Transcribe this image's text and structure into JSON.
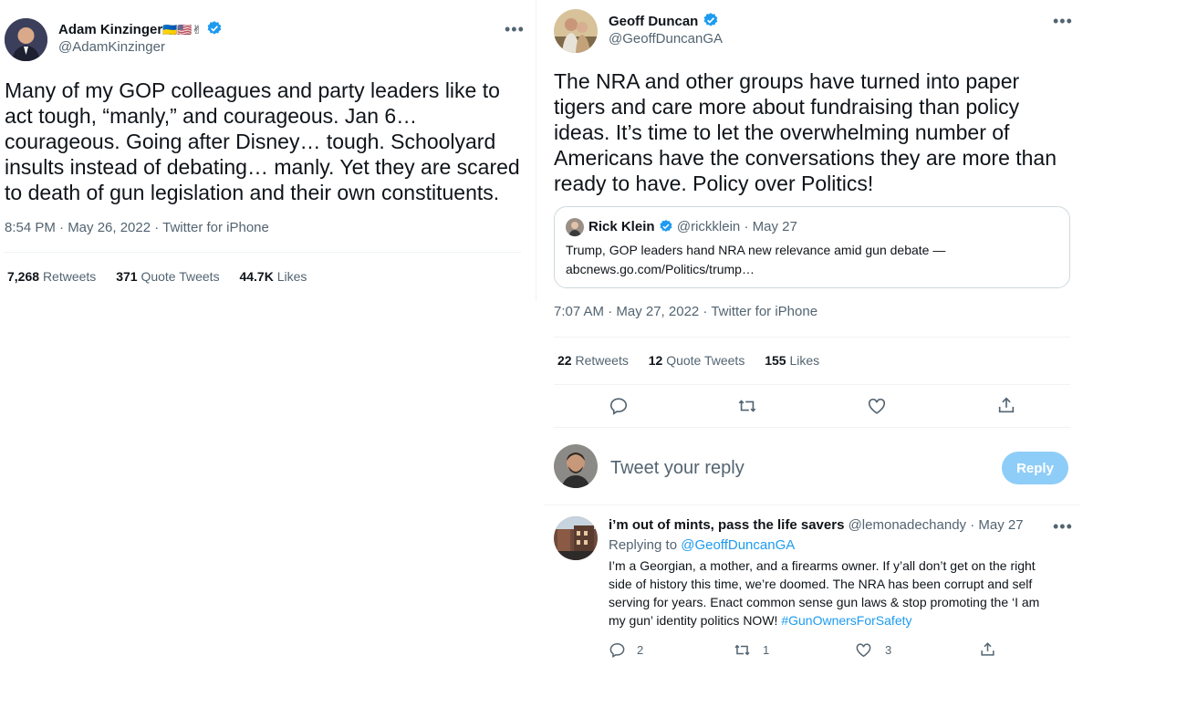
{
  "left_tweet": {
    "name": "Adam Kinzinger",
    "name_emoji": "🇺🇦🇺🇸✌",
    "handle": "@AdamKinzinger",
    "lines": [
      "Many of my GOP colleagues and party leaders like to",
      "act tough, “manly,” and courageous.  Jan 6…",
      "courageous.  Going after Disney… tough. Schoolyard",
      "insults instead of debating… manly. Yet they are scared",
      "to death of gun legislation and their own constituents."
    ],
    "meta": "8:54 PM · May 26, 2022 · Twitter for iPhone",
    "stats": {
      "retweets_num": "7,268",
      "retweets_label": "Retweets",
      "quotes_num": "371",
      "quotes_label": "Quote Tweets",
      "likes_num": "44.7K",
      "likes_label": "Likes"
    }
  },
  "right_tweet": {
    "name": "Geoff Duncan",
    "handle": "@GeoffDuncanGA",
    "lines": [
      "The NRA and other groups have turned into paper",
      "tigers and care more about fundraising than policy",
      "ideas. It’s time to let the overwhelming number of",
      "Americans have the conversations they are more than",
      "ready to have. Policy over Politics!"
    ],
    "quoted": {
      "name": "Rick Klein",
      "handle_date": "@rickklein · May 27",
      "line1": "Trump, GOP leaders hand NRA new relevance amid gun debate —",
      "line2": "abcnews.go.com/Politics/trump…"
    },
    "meta": "7:07 AM · May 27, 2022 · Twitter for iPhone",
    "stats": {
      "retweets_num": "22",
      "retweets_label": "Retweets",
      "quotes_num": "12",
      "quotes_label": "Quote Tweets",
      "likes_num": "155",
      "likes_label": "Likes"
    }
  },
  "reply_box": {
    "placeholder": "Tweet your reply",
    "button": "Reply"
  },
  "reply_tweet": {
    "name": "i’m out of mints, pass the life savers",
    "handle_date": "@lemonadechandy · May 27",
    "replying_prefix": "Replying to",
    "replying_handle": "@GeoffDuncanGA",
    "lines": [
      "I’m a Georgian, a mother, and a firearms owner. If y’all don’t get on the right",
      "side of history this time, we’re doomed. The NRA has been corrupt and self",
      "serving for years. Enact common sense gun laws & stop promoting the ‘I am"
    ],
    "last_line": "my gun’ identity politics NOW!",
    "hashtag": "#GunOwnersForSafety",
    "reply_count": "2",
    "retweet_count": "1",
    "like_count": "3"
  },
  "colors": {
    "accent": "#1d9bf0",
    "reply_button_disabled": "#8ecdf8",
    "text_muted": "#536471"
  }
}
